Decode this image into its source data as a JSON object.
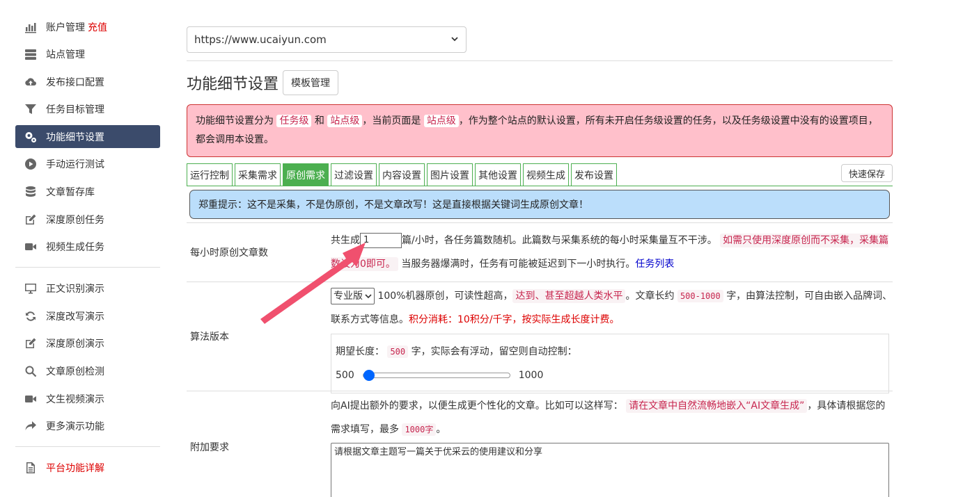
{
  "sidebar": {
    "group1": [
      {
        "label": "账户管理",
        "extra": "充值",
        "icon": "bar-chart-icon"
      },
      {
        "label": "站点管理",
        "icon": "server-icon"
      },
      {
        "label": "发布接口配置",
        "icon": "cloud-upload-icon"
      },
      {
        "label": "任务目标管理",
        "icon": "filter-icon"
      },
      {
        "label": "功能细节设置",
        "icon": "gears-icon",
        "active": true
      },
      {
        "label": "手动运行测试",
        "icon": "play-circle-icon"
      },
      {
        "label": "文章暂存库",
        "icon": "database-icon"
      },
      {
        "label": "深度原创任务",
        "icon": "edit-icon"
      },
      {
        "label": "视频生成任务",
        "icon": "video-icon"
      }
    ],
    "group2": [
      {
        "label": "正文识别演示",
        "icon": "monitor-icon"
      },
      {
        "label": "深度改写演示",
        "icon": "refresh-icon"
      },
      {
        "label": "深度原创演示",
        "icon": "edit-icon"
      },
      {
        "label": "文章原创检测",
        "icon": "search-icon"
      },
      {
        "label": "文生视频演示",
        "icon": "video-icon"
      },
      {
        "label": "更多演示功能",
        "icon": "share-icon"
      }
    ],
    "group3": [
      {
        "label": "平台功能详解",
        "icon": "document-icon"
      }
    ]
  },
  "site_select": {
    "value": "https://www.ucaiyun.com"
  },
  "page_title": "功能细节设置",
  "template_button": "模板管理",
  "alert_pink": {
    "t1": "功能细节设置分为",
    "tag1": "任务级",
    "t2": "和",
    "tag2": "站点级",
    "t3": "，当前页面是",
    "tag3": "站点级",
    "t4": "，作为整个站点的默认设置，所有未开启任务级设置的任务，以及任务级设置中没有的设置项目，都会调用本设置。"
  },
  "tabs": [
    "运行控制",
    "采集需求",
    "原创需求",
    "过滤设置",
    "内容设置",
    "图片设置",
    "其他设置",
    "视频生成",
    "发布设置"
  ],
  "active_tab": "原创需求",
  "quick_save": "快速保存",
  "alert_blue": "郑重提示：这不是采集，不是伪原创，不是文章改写！这是直接根据关键词生成原创文章！",
  "hourly": {
    "label": "每小时原创文章数",
    "prefix": "共生成",
    "value": "1",
    "t1": "篇/小时，各任务篇数随机。此篇数与采集系统的每小时采集量互不干涉。",
    "hl": "如需只使用深度原创而不采集，采集篇数设为0即可。",
    "t2": "当服务器爆满时，任务有可能被延迟到下一小时执行。",
    "link": "任务列表"
  },
  "algo": {
    "label": "算法版本",
    "select": "专业版",
    "t1": "100%机器原创，可读性超高，",
    "hl": "达到、甚至超越人类水平",
    "t2": "。文章长约",
    "code": "500-1000",
    "t3": "字，由算法控制，可自由嵌入品牌词、联系方式等信息。",
    "red": "积分消耗：10积分/千字，按实际生成长度计费。",
    "len_prefix": "期望长度：",
    "len_value": "500",
    "len_suffix": "字，实际会有浮动，留空则自动控制：",
    "slider_min": "500",
    "slider_max": "1000",
    "slider_fraction": 0
  },
  "extra_req": {
    "label": "附加要求",
    "t1": "向AI提出额外的要求，以便生成更个性化的文章。比如可以这样写：",
    "hl": "请在文章中自然流畅地嵌入“AI文章生成”",
    "t2": "，具体请根据您的需求填写，最多",
    "code": "1000字",
    "t3": "。",
    "placeholder": "请根据文章主题写一篇关于优采云的使用建议和分享"
  },
  "colors": {
    "active_nav": "#3b4b6b",
    "tab_green": "#4caf50",
    "alert_pink": "#ffc0cb",
    "alert_blue": "#bbdefb",
    "arrow": "#f0506e"
  }
}
